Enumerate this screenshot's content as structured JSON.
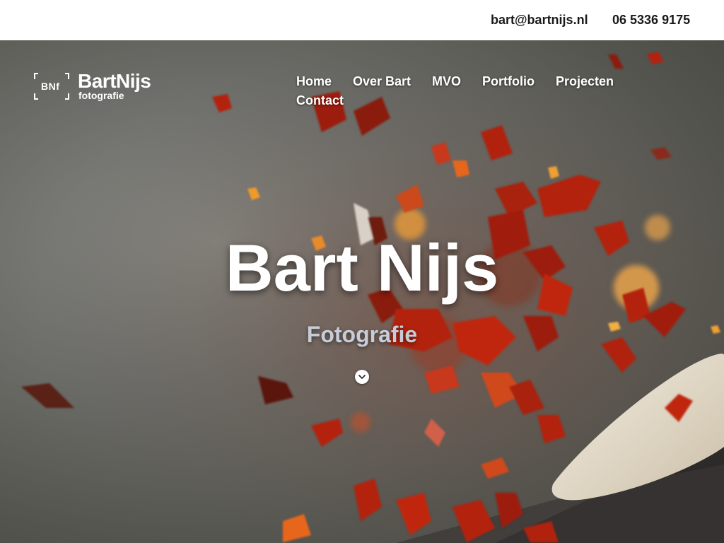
{
  "topbar": {
    "email": "bart@bartnijs.nl",
    "phone": "06 5336 9175"
  },
  "logo": {
    "mark": "BNf",
    "brand": "BartNijs",
    "tagline": "fotografie"
  },
  "nav": {
    "items": [
      {
        "label": "Home"
      },
      {
        "label": "Over Bart"
      },
      {
        "label": "MVO"
      },
      {
        "label": "Portfolio"
      },
      {
        "label": "Projecten"
      },
      {
        "label": "Contact"
      }
    ]
  },
  "hero": {
    "title": "Bart Nijs",
    "subtitle": "Fotografie",
    "scroll_icon": "chevron-down-icon",
    "background": "photo of red chili flakes exploding off a wooden spoon"
  },
  "colors": {
    "text_dark": "#1a1a1a",
    "white": "#ffffff",
    "subtitle": "#c7cdd8",
    "chili_red": "#b3200c",
    "chili_orange": "#e8661a"
  }
}
